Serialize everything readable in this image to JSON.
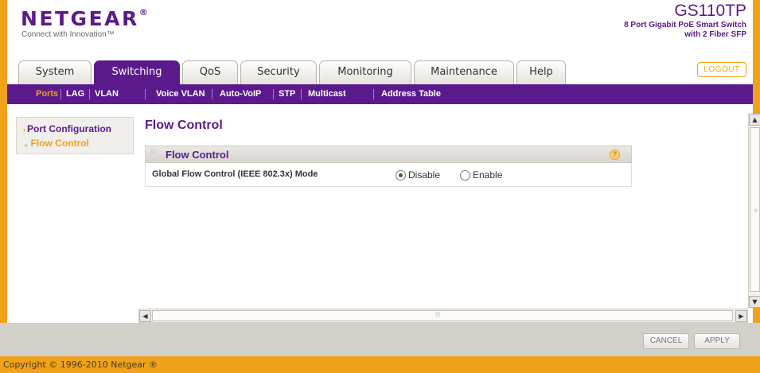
{
  "brand": {
    "logo_text": "NETGEAR",
    "logo_mark": "®",
    "tagline": "Connect with Innovation™"
  },
  "device": {
    "model": "GS110TP",
    "description_line1": "8 Port Gigabit PoE Smart Switch",
    "description_line2": "with 2 Fiber SFP"
  },
  "header": {
    "logout_label": "LOGOUT"
  },
  "tabs": [
    {
      "label": "System",
      "active": false
    },
    {
      "label": "Switching",
      "active": true
    },
    {
      "label": "QoS",
      "active": false
    },
    {
      "label": "Security",
      "active": false
    },
    {
      "label": "Monitoring",
      "active": false
    },
    {
      "label": "Maintenance",
      "active": false
    },
    {
      "label": "Help",
      "active": false
    }
  ],
  "subnav": [
    {
      "label": "Ports",
      "active": true
    },
    {
      "label": "LAG",
      "active": false
    },
    {
      "label": "VLAN",
      "active": false
    },
    {
      "label": "Voice VLAN",
      "active": false
    },
    {
      "label": "Auto-VoIP",
      "active": false
    },
    {
      "label": "STP",
      "active": false
    },
    {
      "label": "Multicast",
      "active": false
    },
    {
      "label": "Address Table",
      "active": false
    }
  ],
  "sidebar": {
    "items": [
      {
        "label": "Port Configuration",
        "active": false
      },
      {
        "label": "Flow Control",
        "active": true
      }
    ]
  },
  "main": {
    "page_title": "Flow Control",
    "panel_title": "Flow Control",
    "help_glyph": "?",
    "setting_label": "Global Flow Control (IEEE 802.3x) Mode",
    "options": [
      {
        "label": "Disable",
        "selected": true
      },
      {
        "label": "Enable",
        "selected": false
      }
    ]
  },
  "actions": {
    "cancel_label": "CANCEL",
    "apply_label": "APPLY"
  },
  "footer": {
    "copyright": "Copyright © 1996-2010 Netgear ®"
  },
  "colors": {
    "brand_purple": "#5a1a8c",
    "accent_orange": "#f0a21a"
  }
}
